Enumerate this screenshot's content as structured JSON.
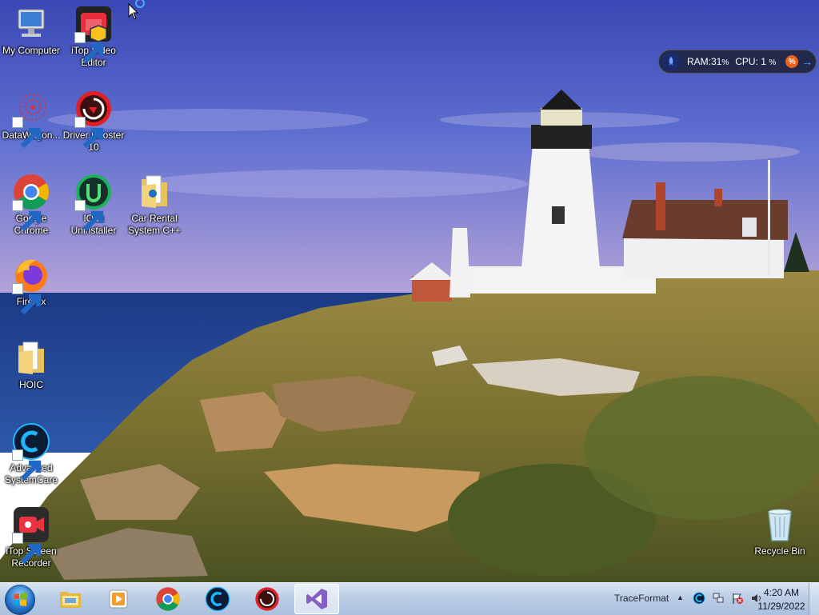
{
  "desktop": {
    "icons": [
      {
        "id": "my-computer",
        "label": "My Computer"
      },
      {
        "id": "itop-video-editor",
        "label": "iTop Video\nEditor"
      },
      {
        "id": "datawagon",
        "label": "DataWagon..."
      },
      {
        "id": "driver-booster",
        "label": "Driver Booster\n10"
      },
      {
        "id": "google-chrome",
        "label": "Google\nChrome"
      },
      {
        "id": "iobit-uninstaller",
        "label": "IObit\nUninstaller"
      },
      {
        "id": "car-rental",
        "label": "Car Rental\nSystem C++"
      },
      {
        "id": "firefox",
        "label": "Firefox"
      },
      {
        "id": "hoic",
        "label": "HOIC"
      },
      {
        "id": "advanced-systemcare",
        "label": "Advanced\nSystemCare"
      },
      {
        "id": "itop-screen-recorder",
        "label": "iTop Screen\nRecorder"
      },
      {
        "id": "recycle-bin",
        "label": "Recycle Bin"
      }
    ]
  },
  "gadget": {
    "ram_label": "RAM:",
    "ram_value": "31",
    "ram_unit": "%",
    "cpu_label": "CPU:",
    "cpu_value": "1",
    "cpu_unit": "%",
    "pct_button": "%",
    "arrow_button": "→"
  },
  "taskbar": {
    "pinned": [
      "file-explorer",
      "media-player",
      "google-chrome",
      "advanced-systemcare",
      "driver-booster",
      "visual-studio"
    ],
    "active": "visual-studio",
    "tray": {
      "toolbar_label": "TraceFormat",
      "chevron": "▲",
      "time": "4:20 AM",
      "date": "11/29/2022"
    }
  },
  "colors": {
    "taskbar": "#b9cce4",
    "sky_top": "#3f4fb8",
    "sea": "#1f3f8a",
    "grass": "#8a7a3a"
  }
}
